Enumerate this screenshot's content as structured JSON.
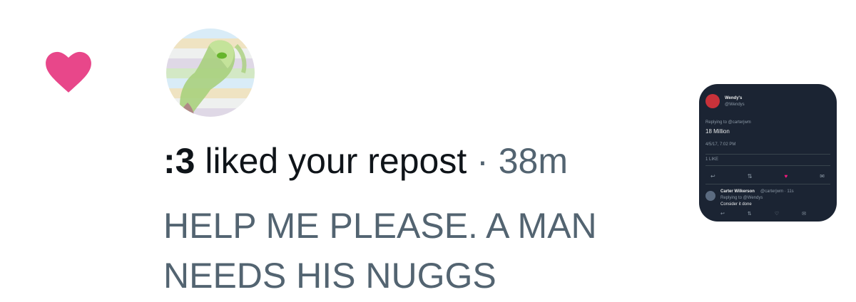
{
  "notification": {
    "icon": "heart-icon",
    "icon_color": "#e8478a",
    "user_name": ":3",
    "action": "liked your repost",
    "separator": "·",
    "time": "38m",
    "post_text": "HELP ME PLEASE. A MAN NEEDS HIS NUGGS"
  },
  "thumbnail": {
    "name": "Wendy's",
    "handle": "@Wendys",
    "replying": "Replying to @carterjwm",
    "text": "18 Million",
    "date": "4/5/17, 7:02 PM",
    "likes": "1 LIKE",
    "action_icons": [
      "reply-icon",
      "retweet-icon",
      "like-icon",
      "dm-icon"
    ],
    "reply_name": "Carter Wilkerson",
    "reply_handle": "@carterjwm · 11s",
    "reply_replying": "Replying to @Wendys",
    "reply_text": "Consider it done"
  }
}
